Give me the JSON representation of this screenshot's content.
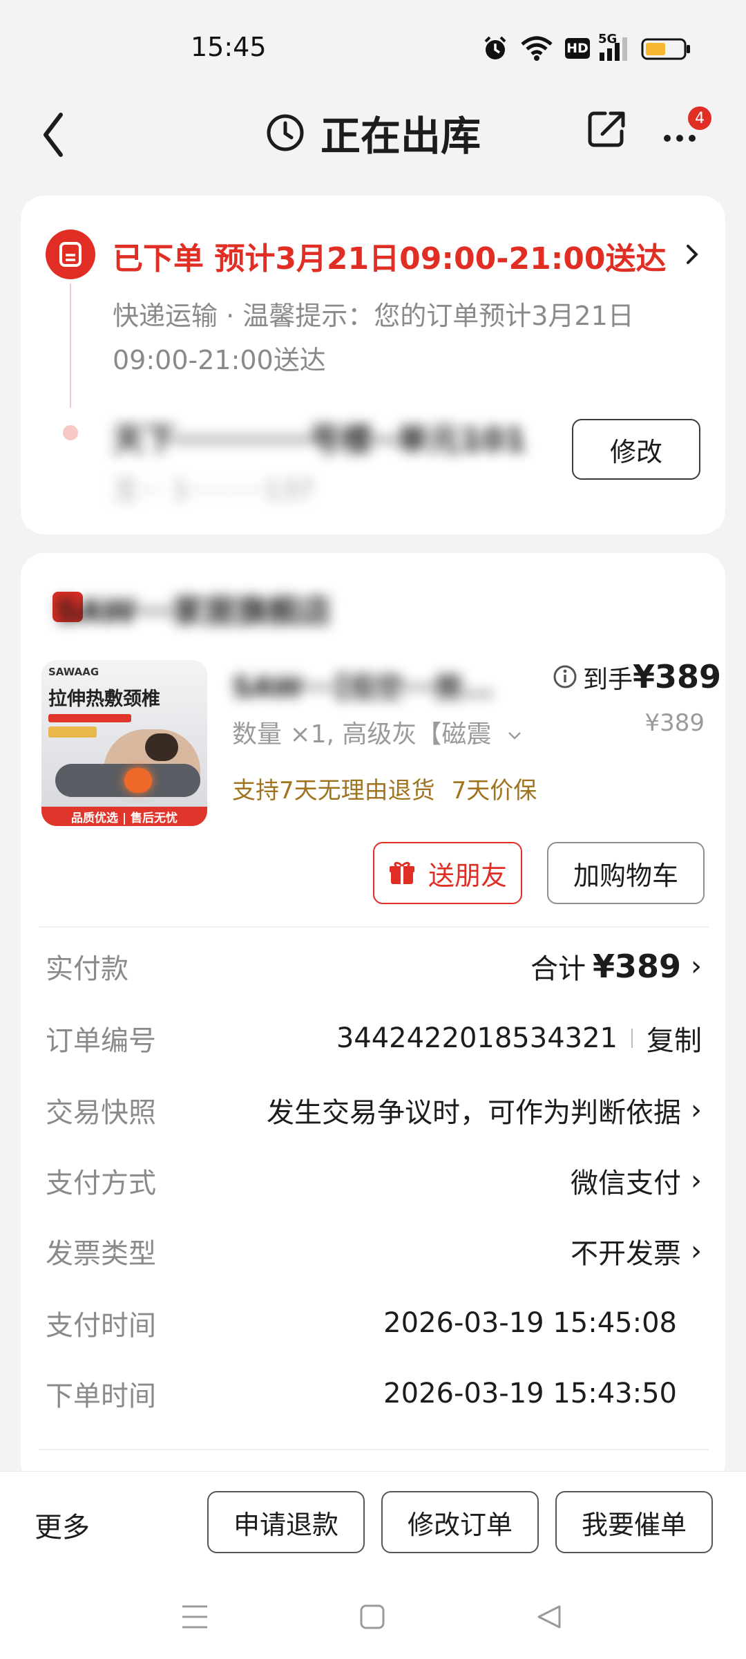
{
  "status_bar": {
    "time": "15:45",
    "icons": [
      "alarm-icon",
      "wifi-icon",
      "hd-icon",
      "5g-signal-icon",
      "battery-icon"
    ],
    "hd_label": "HD",
    "network_label": "5G"
  },
  "nav": {
    "title": "正在出库",
    "more_badge": "4"
  },
  "status_card": {
    "headline": "已下单 预计3月21日09:00-21:00送达",
    "description": "快递运输 · 温馨提示：您的订单预计3月21日09:00-21:00送达",
    "address": "天下···········号楼··单元101",
    "contact": "王··· 1·········137",
    "modify_button": "修改"
  },
  "order_card": {
    "store_name": "SAW···家居旗舰店",
    "product": {
      "title": "SAW···【低空···按...",
      "final_price_label": "到手",
      "final_price": "¥389",
      "original_price": "¥389",
      "spec": "数量 ×1, 高级灰【磁震",
      "guarantees": [
        "支持7天无理由退货",
        "7天价保"
      ],
      "image_caption": "拉伸热敷颈椎",
      "image_brand": "SAWAAG",
      "image_footer": "品质优选 | 售后无忧"
    },
    "gift_button": "送朋友",
    "cart_button": "加购物车",
    "details": {
      "paid_label": "实付款",
      "paid_total_prefix": "合计",
      "paid_total": "¥389",
      "order_no_label": "订单编号",
      "order_no": "3442422018534321",
      "copy_label": "复制",
      "snapshot_label": "交易快照",
      "snapshot_value": "发生交易争议时，可作为判断依据",
      "pay_method_label": "支付方式",
      "pay_method_value": "微信支付",
      "invoice_label": "发票类型",
      "invoice_value": "不开发票",
      "pay_time_label": "支付时间",
      "pay_time_value": "2026-03-19 15:45:08",
      "order_time_label": "下单时间",
      "order_time_value": "2026-03-19 15:43:50"
    }
  },
  "bottom_bar": {
    "more": "更多",
    "refund": "申请退款",
    "modify_order": "修改订单",
    "urge": "我要催单"
  },
  "colors": {
    "accent": "#e02e24",
    "guarantee": "#a0741f",
    "muted": "#8a8a8a",
    "background": "#f3f3f3"
  }
}
